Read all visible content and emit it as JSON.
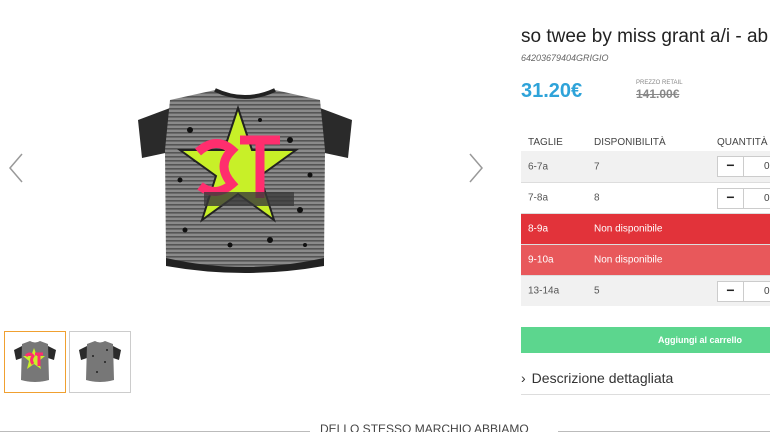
{
  "product": {
    "title": "so twee by miss grant a/i - ab",
    "sku": "64203679404GRIGIO",
    "price": "31.20€",
    "retail_label": "PREZZO RETAIL",
    "retail_price": "141.00€"
  },
  "sizes_table": {
    "headers": {
      "size": "TAGLIE",
      "availability": "DISPONIBILITÀ",
      "quantity": "QUANTITÀ"
    },
    "rows": [
      {
        "size": "6-7a",
        "availability": "7",
        "qty": "0",
        "available": true
      },
      {
        "size": "7-8a",
        "availability": "8",
        "qty": "0",
        "available": true
      },
      {
        "size": "8-9a",
        "availability": "Non disponibile",
        "available": false
      },
      {
        "size": "9-10a",
        "availability": "Non disponibile",
        "available": false
      },
      {
        "size": "13-14a",
        "availability": "5",
        "qty": "0",
        "available": true
      }
    ],
    "minus_label": "−"
  },
  "cart": {
    "button_label": "Aggiungi al carrello"
  },
  "description": {
    "chevron": "›",
    "label": "Descrizione dettagliata"
  },
  "same_brand": {
    "label": "DELLO STESSO MARCHIO ABBIAMO"
  },
  "colors": {
    "price_blue": "#2ea3d9",
    "unavailable_red": "#e2333a",
    "cart_green": "#5cd68e",
    "thumb_active": "#f0a030"
  },
  "icons": [
    "chevron-left-icon",
    "chevron-right-icon"
  ]
}
